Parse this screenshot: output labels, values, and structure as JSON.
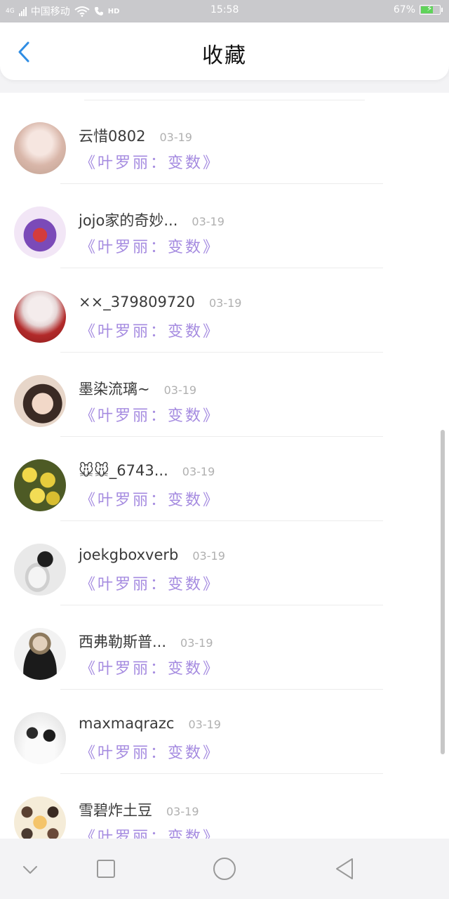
{
  "status_bar": {
    "network": "4G",
    "carrier": "中国移动",
    "hd": "HD",
    "time": "15:58",
    "battery": "67%",
    "battery_level": 0.67,
    "battery_color": "#5fd35a"
  },
  "header": {
    "title": "收藏",
    "back_icon": "chevron-left-icon",
    "accent": "#2f8de4"
  },
  "list": {
    "items": [
      {
        "name": "云惜0802",
        "date": "03-19",
        "title": "《叶罗丽：变数》"
      },
      {
        "name": "jojo家的奇妙...",
        "date": "03-19",
        "title": "《叶罗丽：变数》"
      },
      {
        "name": "××_379809720",
        "date": "03-19",
        "title": "《叶罗丽：变数》"
      },
      {
        "name": "墨染流璃~",
        "date": "03-19",
        "title": "《叶罗丽：变数》"
      },
      {
        "name": "🐭🐭_6743...",
        "date": "03-19",
        "title": "《叶罗丽：变数》"
      },
      {
        "name": "joekgboxverb",
        "date": "03-19",
        "title": "《叶罗丽：变数》"
      },
      {
        "name": "西弗勒斯普...",
        "date": "03-19",
        "title": "《叶罗丽：变数》"
      },
      {
        "name": "maxmaqrazc",
        "date": "03-19",
        "title": "《叶罗丽：变数》"
      },
      {
        "name": "雪碧炸土豆",
        "date": "03-19",
        "title": "《叶罗丽：变数》"
      }
    ],
    "title_color": "#a58be0"
  },
  "navbar": {
    "buttons": [
      "chevron-down-icon",
      "recent-apps-square-icon",
      "home-circle-icon",
      "back-triangle-icon"
    ]
  }
}
